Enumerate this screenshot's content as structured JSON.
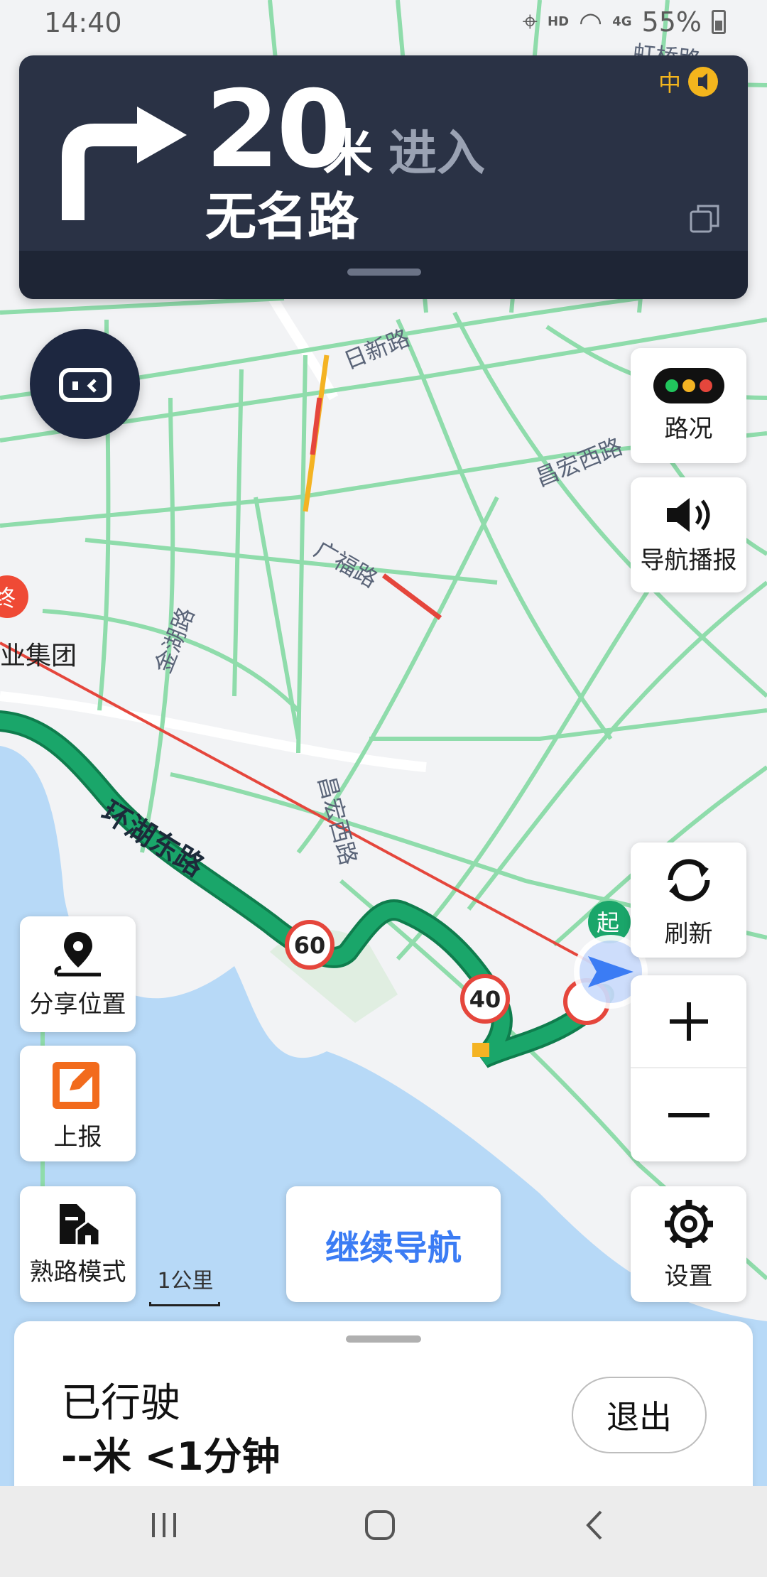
{
  "status_bar": {
    "time": "14:40",
    "hd_label": "HD",
    "network": "4G",
    "battery": "55%"
  },
  "nav_card": {
    "distance": "20",
    "unit": "米",
    "action": "进入",
    "road_name": "无名路",
    "volume_level": "中"
  },
  "map_labels": {
    "hongqiao": "虹桥路",
    "rixin": "日新路",
    "changhong_xi_1": "昌宏西路",
    "guangfu": "广福路",
    "jinhu": "金湖路",
    "group": "业集团",
    "huanhu_dong": "环湖东路",
    "changhong_xi_2": "昌宏西路",
    "end_marker": "终",
    "start_marker": "起"
  },
  "speed_limits": [
    "60",
    "40"
  ],
  "right_buttons": {
    "traffic": "路况",
    "voice": "导航播报",
    "refresh": "刷新",
    "settings": "设置"
  },
  "left_buttons": {
    "share": "分享位置",
    "report": "上报",
    "familiar": "熟路模式"
  },
  "scale_label": "1公里",
  "continue_label": "继续导航",
  "bottom_panel": {
    "driven_label": "已行驶",
    "driven_value": "--米 <1分钟",
    "exit_label": "退出"
  },
  "colors": {
    "nav_card_bg": "#2a3245",
    "route_green": "#1aa66a",
    "road_green": "#8fdcab",
    "water": "#b7d9f7",
    "accent_blue": "#3b7cf4",
    "end_red": "#ef4a35",
    "start_green": "#1aa66a"
  }
}
